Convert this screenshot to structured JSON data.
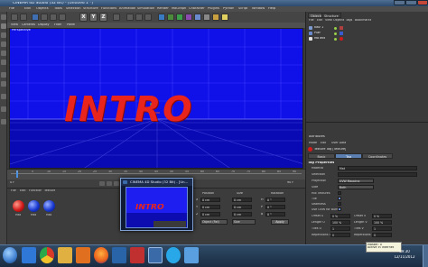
{
  "window": {
    "title": "CINEMA 4D Studio (32 Bit) - [Untitled 1 *]"
  },
  "menu": {
    "items": [
      "File",
      "Edit",
      "Objects",
      "Tools",
      "Selection",
      "Structure",
      "Functions",
      "Animation",
      "Simulation",
      "Render",
      "MoGraph",
      "Character",
      "Plugins",
      "Python",
      "Script",
      "Window",
      "Help"
    ]
  },
  "toolbar": {
    "xyz": [
      "X",
      "Y",
      "Z"
    ]
  },
  "viewport": {
    "menu": [
      "View",
      "Cameras",
      "Display",
      "Filter",
      "Panel"
    ],
    "label": "Perspective",
    "text3d": "INTRO",
    "bg_color": "#1010e8",
    "text_color": "#e8241c"
  },
  "timeline": {
    "ticks": [
      "0",
      "5",
      "10",
      "15",
      "20",
      "25",
      "30",
      "35",
      "40",
      "45",
      "50",
      "55",
      "60",
      "65",
      "70",
      "75",
      "80",
      "85",
      "90"
    ],
    "frame_start": "0 F",
    "frame_end": "90 F"
  },
  "materials": {
    "menu": [
      "File",
      "Edit",
      "Function",
      "Texture"
    ],
    "items": [
      {
        "label": "Mat",
        "color": "#d21a1a"
      },
      {
        "label": "Mat",
        "color": "#1a3ad2"
      },
      {
        "label": "Mat",
        "color": "#1a3ad2"
      }
    ]
  },
  "preview": {
    "title": "CINEMA 4D Studio (32 Bit) - [Un...",
    "text": "INTRO"
  },
  "coords": {
    "headers": [
      "Position",
      "Size",
      "Rotation"
    ],
    "rows": [
      {
        "axis": "X",
        "pos": "0 cm",
        "size": "0 cm",
        "rot_lbl": "H",
        "rot": "0 °"
      },
      {
        "axis": "Y",
        "pos": "0 cm",
        "size": "0 cm",
        "rot_lbl": "P",
        "rot": "0 °"
      },
      {
        "axis": "Z",
        "pos": "0 cm",
        "size": "0 cm",
        "rot_lbl": "B",
        "rot": "0 °"
      }
    ],
    "mode_select": "Object (Rel)",
    "size_select": "Size",
    "apply": "Apply"
  },
  "objects": {
    "tabs": [
      "Objects",
      "Structure"
    ],
    "menu": [
      "File",
      "Edit",
      "View",
      "Objects",
      "Tags",
      "Bookmarks"
    ],
    "rows": [
      {
        "name": "Nav 1",
        "dot": "#9ad04a"
      },
      {
        "name": "Plan",
        "dot": "#9ad04a"
      },
      {
        "name": "MoText",
        "dot": "#9ad04a"
      }
    ]
  },
  "attributes": {
    "header": "Attributes",
    "menu": [
      "Mode",
      "Edit",
      "User Data"
    ],
    "tag_title": "Texture Tag [Texture]",
    "tabs": [
      "Basic",
      "Tag",
      "Coordinates"
    ],
    "section": "Tag Properties",
    "fields": [
      {
        "label": "Material",
        "value": "Mat"
      },
      {
        "label": "Selection",
        "value": ""
      },
      {
        "label": "Projection",
        "value": "UVW Mapping"
      },
      {
        "label": "Side",
        "value": "Both"
      }
    ],
    "checks": [
      "Mix Textures",
      "Tile",
      "Seamless",
      "Use UVW for Bump"
    ],
    "offsets": [
      {
        "l1": "Offset U",
        "v1": "0 %",
        "l2": "Offset V",
        "v2": "0 %"
      },
      {
        "l1": "Length U",
        "v1": "100 %",
        "l2": "Length V",
        "v2": "100 %"
      },
      {
        "l1": "Tiles U",
        "v1": "1",
        "l2": "Tiles V",
        "v2": "1"
      },
      {
        "l1": "Repetitions U",
        "v1": "0",
        "l2": "Repetitions V",
        "v2": "0"
      }
    ]
  },
  "taskbar": {
    "icons": [
      {
        "name": "start-orb-icon",
        "color": "#3f7fcf"
      },
      {
        "name": "ie-icon",
        "color": "#2f78d8"
      },
      {
        "name": "chrome-icon",
        "color": "#d8d8d8"
      },
      {
        "name": "folder-icon",
        "color": "#e0b040"
      },
      {
        "name": "media-icon",
        "color": "#e07020"
      },
      {
        "name": "firefox-icon",
        "color": "#e8601c"
      },
      {
        "name": "photoshop-icon",
        "color": "#2a64a8"
      },
      {
        "name": "flash-icon",
        "color": "#c03030"
      },
      {
        "name": "cinema4d-icon",
        "color": "#3a6aa8"
      },
      {
        "name": "skype-icon",
        "color": "#28a8e8"
      },
      {
        "name": "chat-icon",
        "color": "#5aa0e0"
      }
    ],
    "time": "09:30",
    "date": "12/11/2012",
    "tooltip_line1": "Master: 0",
    "tooltip_line2": "Active in Internet"
  }
}
